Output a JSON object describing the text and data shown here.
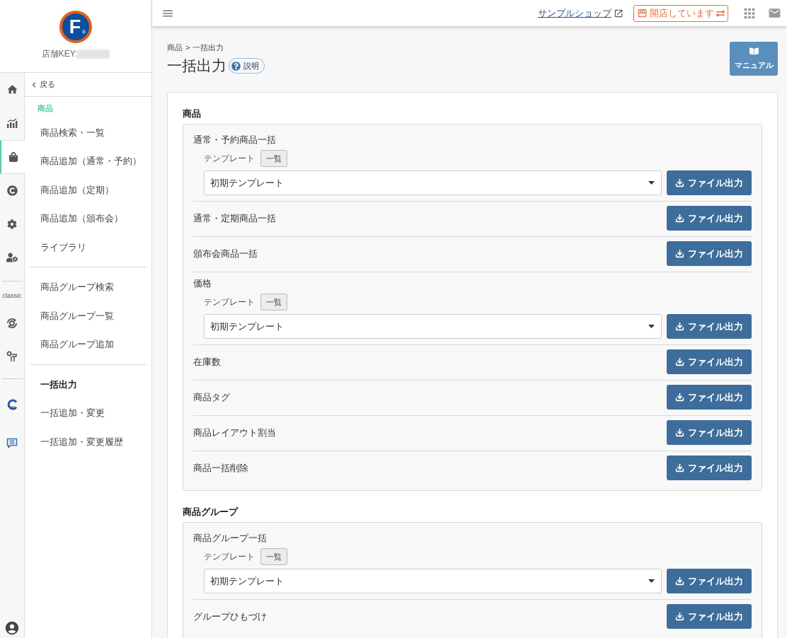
{
  "sidebar": {
    "logo": {
      "letter": "F",
      "mark": "®"
    },
    "store_key_label": "店舗KEY:",
    "rail": {
      "main": [
        {
          "selected": false
        },
        {
          "selected": false
        },
        {
          "selected": true
        },
        {
          "selected": false
        },
        {
          "selected": false
        },
        {
          "selected": false
        }
      ],
      "classic_label": "classic",
      "classic": [
        {
          "selected": false
        },
        {
          "selected": false
        }
      ],
      "extra": [
        {
          "selected": false
        },
        {
          "selected": false
        }
      ]
    },
    "back": "戻る",
    "section_title": "商品",
    "menu_groups": [
      {
        "items": [
          {
            "label": "商品検索・一覧",
            "selected": false
          },
          {
            "label": "商品追加（通常・予約）",
            "selected": false
          },
          {
            "label": "商品追加（定期）",
            "selected": false
          },
          {
            "label": "商品追加（頒布会）",
            "selected": false
          },
          {
            "label": "ライブラリ",
            "selected": false
          }
        ]
      },
      {
        "items": [
          {
            "label": "商品グループ検索",
            "selected": false
          },
          {
            "label": "商品グループ一覧",
            "selected": false
          },
          {
            "label": "商品グループ追加",
            "selected": false
          }
        ]
      },
      {
        "items": [
          {
            "label": "一括出力",
            "selected": true
          },
          {
            "label": "一括追加・変更",
            "selected": false
          },
          {
            "label": "一括追加・変更履歴",
            "selected": false
          }
        ]
      }
    ]
  },
  "header": {
    "shop_link": "サンプルショップ",
    "status": "開店しています"
  },
  "page": {
    "breadcrumb": [
      "商品",
      "一括出力"
    ],
    "breadcrumb_separator": ">",
    "title": "一括出力",
    "help": "説明",
    "manual": "マニュアル"
  },
  "sections": [
    {
      "title": "商品",
      "items": [
        {
          "kind": "template",
          "label": "通常・予約商品一括",
          "template_label": "テンプレート",
          "list_button": "一覧",
          "value": "初期テンプレート",
          "button": "ファイル出力"
        },
        {
          "kind": "plain",
          "label": "通常・定期商品一括",
          "button": "ファイル出力"
        },
        {
          "kind": "plain",
          "label": "頒布会商品一括",
          "button": "ファイル出力"
        },
        {
          "kind": "template",
          "label": "価格",
          "template_label": "テンプレート",
          "list_button": "一覧",
          "value": "初期テンプレート",
          "button": "ファイル出力"
        },
        {
          "kind": "plain",
          "label": "在庫数",
          "button": "ファイル出力"
        },
        {
          "kind": "plain",
          "label": "商品タグ",
          "button": "ファイル出力"
        },
        {
          "kind": "plain",
          "label": "商品レイアウト割当",
          "button": "ファイル出力"
        },
        {
          "kind": "plain",
          "label": "商品一括削除",
          "button": "ファイル出力"
        }
      ]
    },
    {
      "title": "商品グループ",
      "items": [
        {
          "kind": "template",
          "label": "商品グループ一括",
          "template_label": "テンプレート",
          "list_button": "一覧",
          "value": "初期テンプレート",
          "button": "ファイル出力"
        },
        {
          "kind": "plain",
          "label": "グループひもづけ",
          "button": "ファイル出力"
        }
      ]
    }
  ]
}
